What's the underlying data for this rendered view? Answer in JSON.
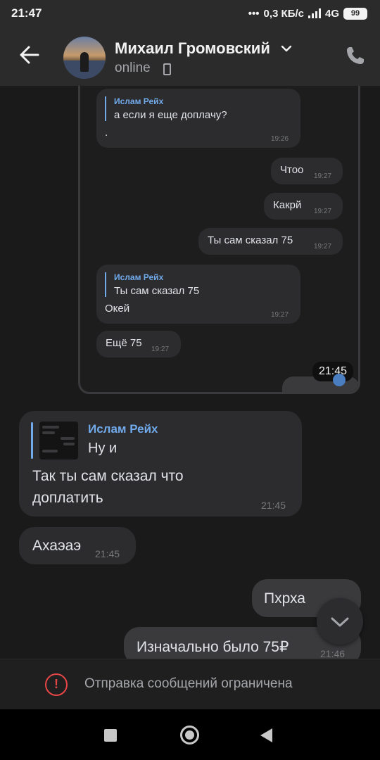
{
  "status_bar": {
    "time": "21:47",
    "network_speed": "0,3 КБ/с",
    "network_type": "4G",
    "battery": "99"
  },
  "header": {
    "contact_name": "Михаил Громовский",
    "status": "online"
  },
  "screenshot": {
    "messages": [
      {
        "quote_name": "Ислам Рейх",
        "quote_text": "а если я еще доплачу?",
        "text": ".",
        "time": "19:26"
      },
      {
        "text": "Чтоо",
        "time": "19:27"
      },
      {
        "text": "Какрй",
        "time": "19:27"
      },
      {
        "text": "Ты сам сказал 75",
        "time": "19:27"
      },
      {
        "quote_name": "Ислам Рейх",
        "quote_text": "Ты сам сказал 75",
        "text": "Окей",
        "time": "19:27"
      },
      {
        "text": "Ещё 75",
        "time": "19:27"
      }
    ],
    "badge_time": "21:45"
  },
  "messages": [
    {
      "reply_name": "Ислам Рейх",
      "reply_text": "Ну и",
      "text_line1": "Так ты сам сказал что",
      "text_line2": "доплатить",
      "time": "21:45"
    },
    {
      "text": "Ахаэаэ",
      "time": "21:45"
    },
    {
      "text": "Пхрха",
      "time": ""
    },
    {
      "text": "Изначально было 75₽",
      "time": "21:46"
    }
  ],
  "banner": {
    "text": "Отправка сообщений ограничена",
    "color": "#e64646"
  },
  "accent_color": "#71aaeb"
}
